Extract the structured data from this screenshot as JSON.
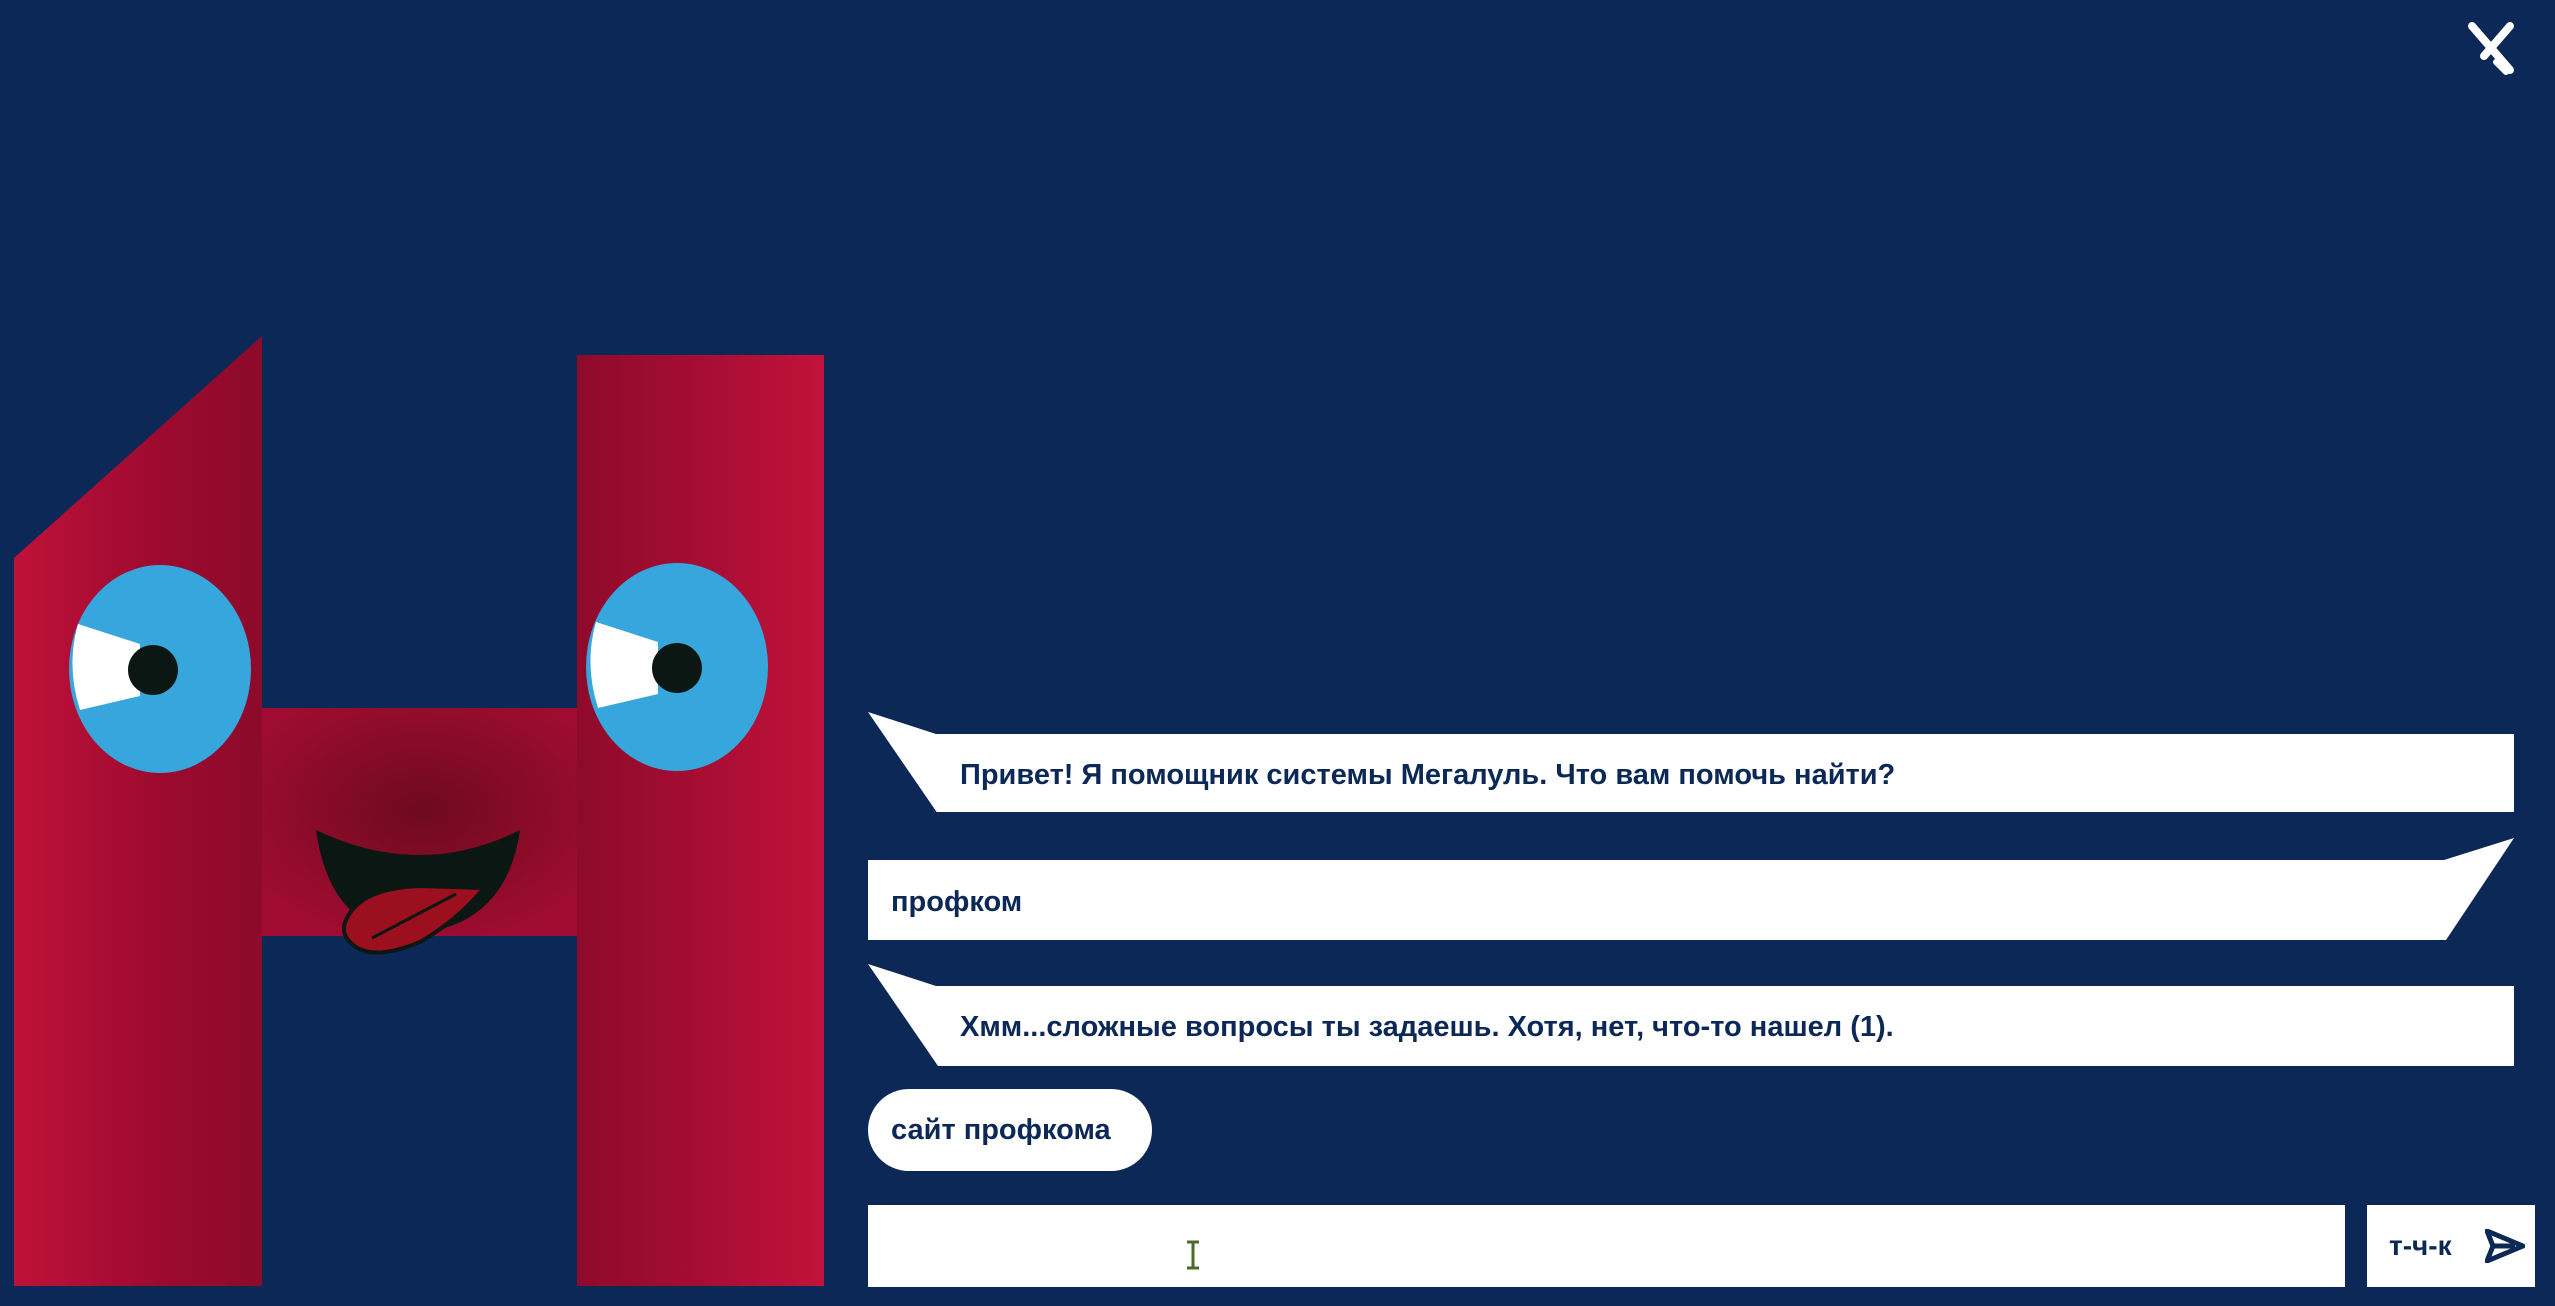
{
  "colors": {
    "background": "#0c2856",
    "bubble": "#ffffff",
    "text": "#0c2856",
    "mascot_red": "#b5103a",
    "mascot_eye": "#37a6dd"
  },
  "window": {
    "close_icon": "close-icon"
  },
  "chat": {
    "messages": [
      {
        "role": "bot",
        "text": "Привет! Я помощник системы Мегалуль. Что вам помочь найти?"
      },
      {
        "role": "user",
        "text": "профком"
      },
      {
        "role": "bot",
        "text": "Хмм...сложные вопросы ты задаешь. Хотя, нет, что-то нашел (1)."
      }
    ],
    "suggestions": [
      {
        "label": "сайт профкома"
      }
    ]
  },
  "composer": {
    "input_value": "",
    "send_label": "т-ч-к",
    "send_icon": "send-arrow-icon"
  }
}
